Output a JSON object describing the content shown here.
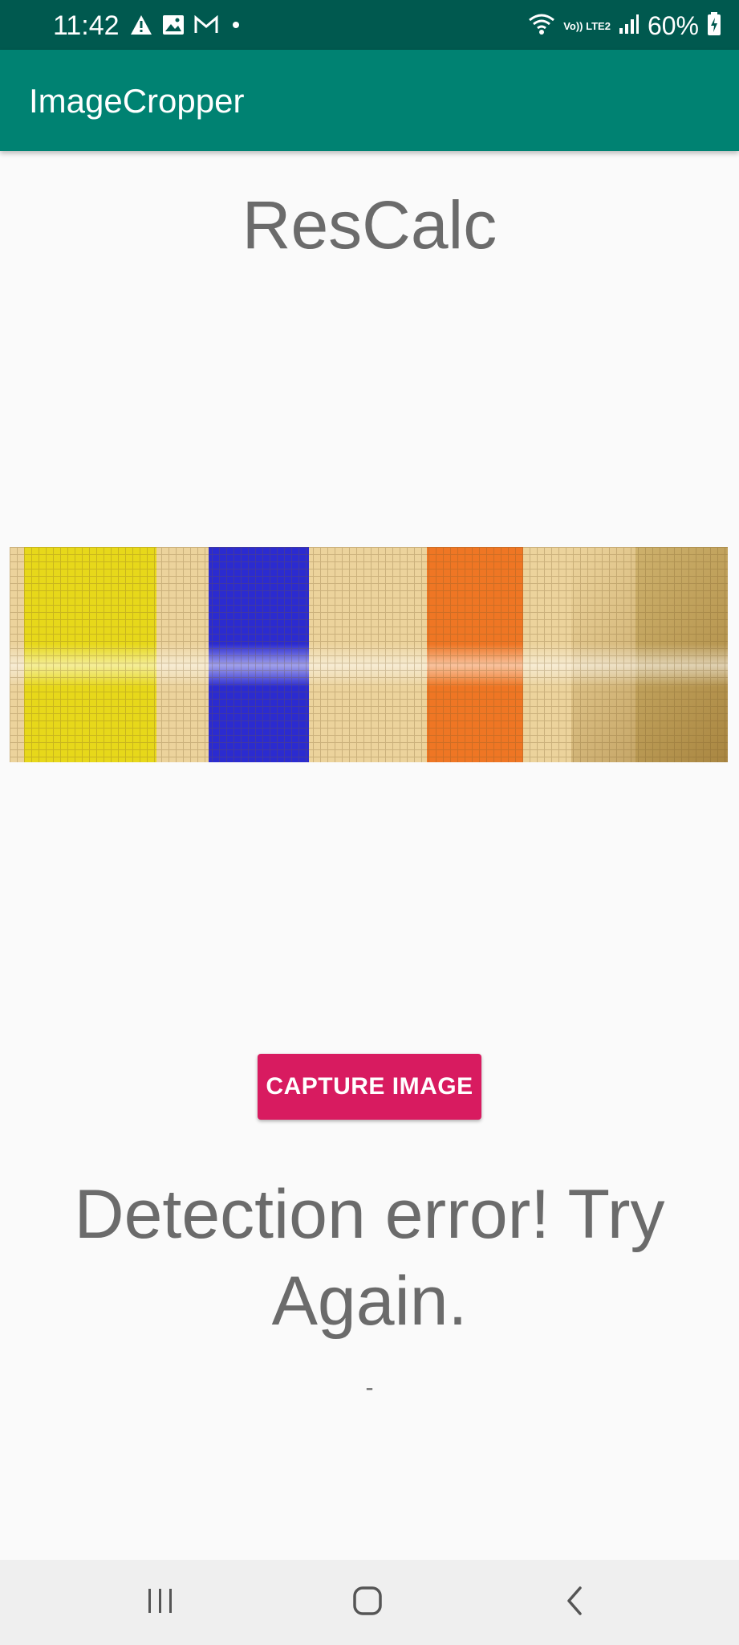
{
  "status_bar": {
    "time": "11:42",
    "left_icons": [
      "alert-icon",
      "image-icon",
      "gmail-icon",
      "dot-icon"
    ],
    "network_label": "Vo)) LTE2",
    "battery_percent": "60%"
  },
  "app_bar": {
    "title": "ImageCropper"
  },
  "main": {
    "heading": "ResCalc",
    "image": {
      "description_icon": "resistor-color-bands-image",
      "bands": [
        {
          "color": "#e7d81a"
        },
        {
          "color": "#2b2bd0"
        },
        {
          "color": "#ef7624"
        },
        {
          "color": "#b79a49"
        }
      ]
    },
    "capture_button_label": "CAPTURE IMAGE",
    "result_message": "Detection error! Try Again.",
    "result_value": "-"
  },
  "nav_bar": {
    "buttons": [
      "recent-apps-icon",
      "home-icon",
      "back-icon"
    ]
  },
  "colors": {
    "status_bar": "#00594f",
    "app_bar": "#008272",
    "accent_button": "#d81b60",
    "text_secondary": "#6b6b6b",
    "background": "#fafafa"
  }
}
